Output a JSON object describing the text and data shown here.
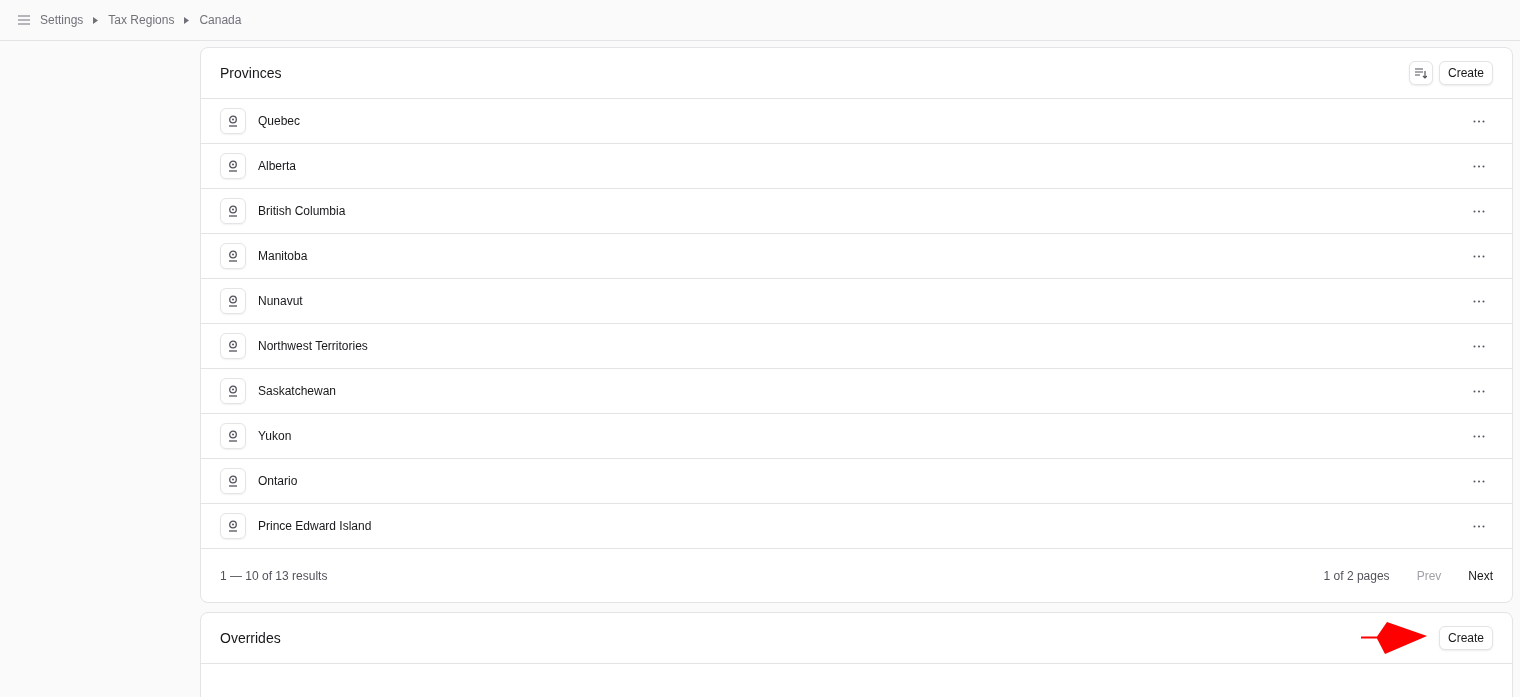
{
  "breadcrumb": [
    "Settings",
    "Tax Regions",
    "Canada"
  ],
  "provinces": {
    "title": "Provinces",
    "create_label": "Create",
    "rows": [
      {
        "name": "Quebec"
      },
      {
        "name": "Alberta"
      },
      {
        "name": "British Columbia"
      },
      {
        "name": "Manitoba"
      },
      {
        "name": "Nunavut"
      },
      {
        "name": "Northwest Territories"
      },
      {
        "name": "Saskatchewan"
      },
      {
        "name": "Yukon"
      },
      {
        "name": "Ontario"
      },
      {
        "name": "Prince Edward Island"
      }
    ],
    "results": "1 — 10 of 13 results",
    "pages": "1 of 2 pages",
    "prev": {
      "label": "Prev",
      "disabled": true
    },
    "next": {
      "label": "Next",
      "disabled": false
    }
  },
  "overrides": {
    "title": "Overrides",
    "create_label": "Create",
    "annotation_arrow": true
  }
}
